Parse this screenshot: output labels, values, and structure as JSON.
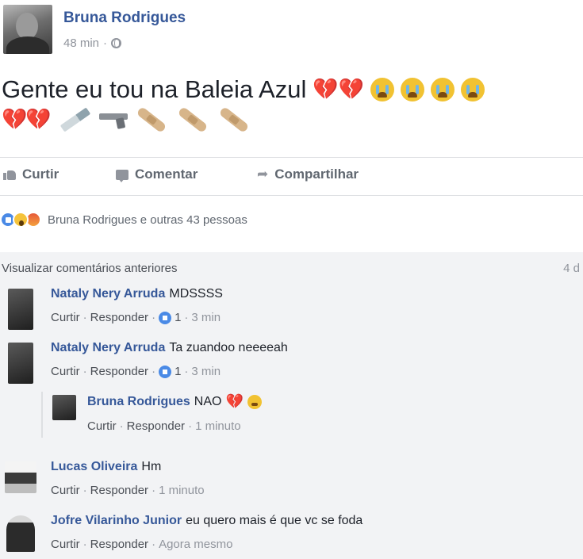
{
  "post": {
    "author": "Bruna Rodrigues",
    "time": "48 min",
    "text": "Gente eu tou na Baleia Azul",
    "text_emojis": [
      "broken-heart",
      "broken-heart",
      "crying-face",
      "crying-face",
      "crying-face",
      "crying-face"
    ],
    "emoji_row": [
      "broken-heart",
      "broken-heart",
      "syringe",
      "pistol",
      "bandage",
      "bandage",
      "bandage"
    ]
  },
  "actions": {
    "like": "Curtir",
    "comment": "Comentar",
    "share": "Compartilhar"
  },
  "reactions": {
    "icons": [
      "like",
      "wow",
      "angry"
    ],
    "text": "Bruna Rodrigues e outras 43 pessoas"
  },
  "comments": {
    "view_previous": "Visualizar comentários anteriores",
    "count_partial": "4 d",
    "items": [
      {
        "name": "Nataly Nery Arruda",
        "text": "MDSSSS",
        "like": "Curtir",
        "reply": "Responder",
        "likes": "1",
        "time": "3 min"
      },
      {
        "name": "Nataly Nery Arruda",
        "text": "Ta zuandoo neeeeah",
        "like": "Curtir",
        "reply": "Responder",
        "likes": "1",
        "time": "3 min"
      },
      {
        "name": "Bruna Rodrigues",
        "text": "NAO",
        "like": "Curtir",
        "reply": "Responder",
        "time": "1 minuto"
      },
      {
        "name": "Lucas Oliveira",
        "text": "Hm",
        "like": "Curtir",
        "reply": "Responder",
        "time": "1 minuto"
      },
      {
        "name": "Jofre Vilarinho Junior",
        "text": "eu quero mais é que vc se foda",
        "like": "Curtir",
        "reply": "Responder",
        "time": "Agora mesmo"
      }
    ]
  },
  "colors": {
    "link_blue": "#365899",
    "meta_gray": "#90949c",
    "background": "#e9ebee",
    "comment_area": "#f2f3f5"
  }
}
